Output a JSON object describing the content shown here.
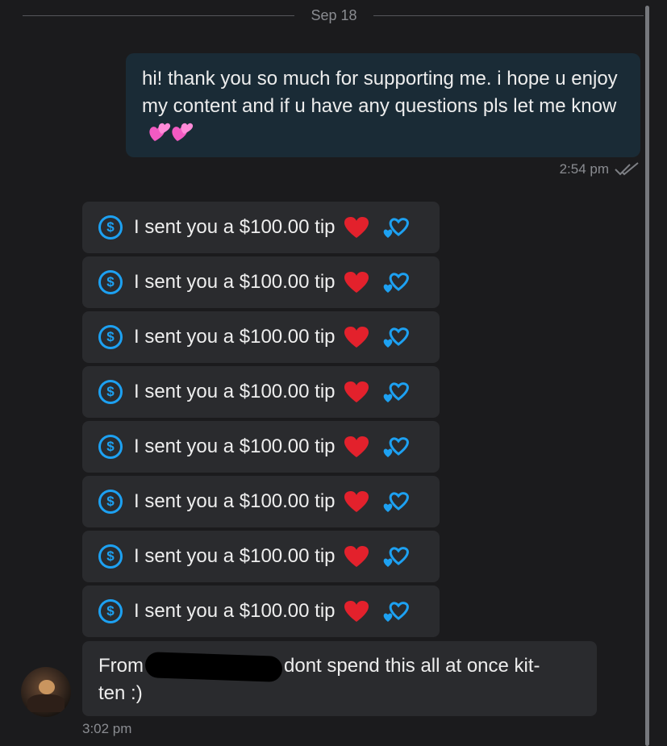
{
  "date_separator": "Sep 18",
  "outgoing_message": {
    "text": "hi! thank you so much for supporting me. i hope u enjoy my content and if u have any questions pls let me know",
    "emoji": "💞💞",
    "time": "2:54 pm",
    "status_icon": "double-check-icon"
  },
  "tips": [
    {
      "text": "I sent you a $100.00 tip"
    },
    {
      "text": "I sent you a $100.00 tip"
    },
    {
      "text": "I sent you a $100.00 tip"
    },
    {
      "text": "I sent you a $100.00 tip"
    },
    {
      "text": "I sent you a $100.00 tip"
    },
    {
      "text": "I sent you a $100.00 tip"
    },
    {
      "text": "I sent you a $100.00 tip"
    },
    {
      "text": "I sent you a $100.00 tip"
    }
  ],
  "tip_icon": "$",
  "incoming_message": {
    "prefix": "From",
    "suffix": "dont spend this all at once kit-",
    "line2": "ten :)",
    "time": "3:02 pm"
  },
  "colors": {
    "background": "#1b1b1d",
    "accent": "#1da1f2",
    "outgoing_bubble": "#1a2b36",
    "incoming_bubble": "#2a2b2e",
    "red_heart": "#e3212c",
    "pink_heart": "#f25ac2"
  }
}
